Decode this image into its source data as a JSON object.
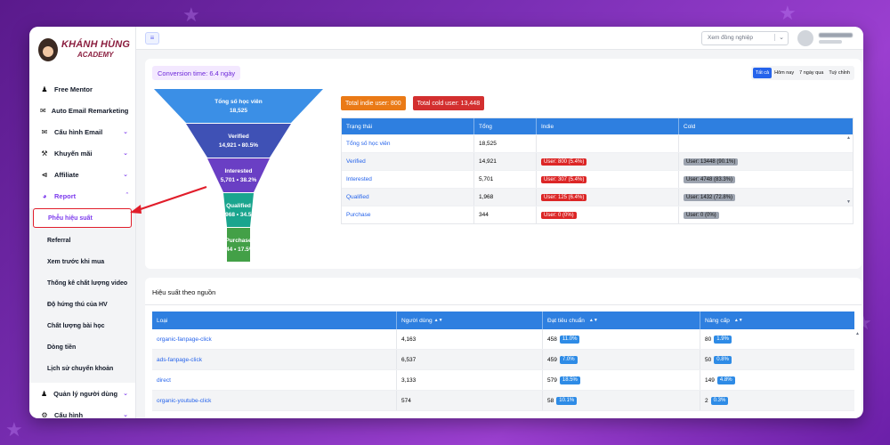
{
  "logo": {
    "main": "KHÁNH HÙNG",
    "sub": "ACADEMY"
  },
  "sidebar": {
    "items": [
      {
        "label": "Free Mentor",
        "icon": "person-icon"
      },
      {
        "label": "Auto Email Remarketing",
        "icon": "mail-icon"
      },
      {
        "label": "Cấu hình Email",
        "icon": "mail-icon"
      },
      {
        "label": "Khuyến mãi",
        "icon": "cart-icon"
      },
      {
        "label": "Affiliate",
        "icon": "share-icon"
      },
      {
        "label": "Report",
        "icon": "chart-icon"
      }
    ],
    "report_sub": [
      "Phễu hiệu suất",
      "Referral",
      "Xem trước khi mua",
      "Thống kê chất lượng video",
      "Độ hứng thú của HV",
      "Chất lượng bài học",
      "Dòng tiền",
      "Lịch sử chuyển khoản"
    ],
    "bottom_items": [
      {
        "label": "Quản lý người dùng",
        "icon": "users-icon"
      },
      {
        "label": "Cấu hình",
        "icon": "gear-icon"
      }
    ]
  },
  "topbar": {
    "colleague_placeholder": "Xem đồng nghiệp"
  },
  "funnel_card": {
    "conversion_time": "Conversion time: 6.4 ngày",
    "ranges": [
      "Tất cả",
      "Hôm nay",
      "7 ngày qua",
      "Tuỳ chỉnh"
    ],
    "funnel": [
      {
        "name": "Tổng số học viên",
        "value": "18,525"
      },
      {
        "name": "Verified",
        "value": "14,921 • 80.5%"
      },
      {
        "name": "Interested",
        "value": "5,701 • 38.2%"
      },
      {
        "name": "Qualified",
        "value": "1,968 • 34.5%"
      },
      {
        "name": "Purchase",
        "value": "344 • 17.5%"
      }
    ],
    "funnel_colors": [
      "#3b8fe6",
      "#3f51b5",
      "#6a3fc4",
      "#1aa58e",
      "#43a047"
    ],
    "total_indie": "Total indie user: 800",
    "total_cold": "Total cold user: 13,448",
    "table": {
      "headers": [
        "Trạng thái",
        "Tổng",
        "Indie",
        "Cold"
      ],
      "rows": [
        {
          "status": "Tổng số học viên",
          "total": "18,525",
          "indie": "",
          "cold": ""
        },
        {
          "status": "Verified",
          "total": "14,921",
          "indie": "User: 800 (5.4%)",
          "cold": "User: 13448 (90.1%)"
        },
        {
          "status": "Interested",
          "total": "5,701",
          "indie": "User: 307 (5.4%)",
          "cold": "User: 4748 (83.3%)"
        },
        {
          "status": "Qualified",
          "total": "1,968",
          "indie": "User: 125 (6.4%)",
          "cold": "User: 1432 (72.8%)"
        },
        {
          "status": "Purchase",
          "total": "344",
          "indie": "User: 0 (0%)",
          "cold": "User: 0 (0%)"
        }
      ]
    }
  },
  "source_card": {
    "title": "Hiệu suất theo nguồn",
    "headers": [
      "Loại",
      "Người dùng",
      "Đạt tiêu chuẩn",
      "Nâng cấp"
    ],
    "rows": [
      {
        "type": "organic-fanpage-click",
        "users": "4,163",
        "qualified": "458",
        "qualified_pct": "11.0%",
        "upgrade": "80",
        "upgrade_pct": "1.9%"
      },
      {
        "type": "ads-fanpage-click",
        "users": "6,537",
        "qualified": "459",
        "qualified_pct": "7.0%",
        "upgrade": "50",
        "upgrade_pct": "0.8%"
      },
      {
        "type": "direct",
        "users": "3,133",
        "qualified": "579",
        "qualified_pct": "18.5%",
        "upgrade": "149",
        "upgrade_pct": "4.8%"
      },
      {
        "type": "organic-youtube-click",
        "users": "574",
        "qualified": "58",
        "qualified_pct": "10.1%",
        "upgrade": "2",
        "upgrade_pct": "0.3%"
      }
    ]
  }
}
